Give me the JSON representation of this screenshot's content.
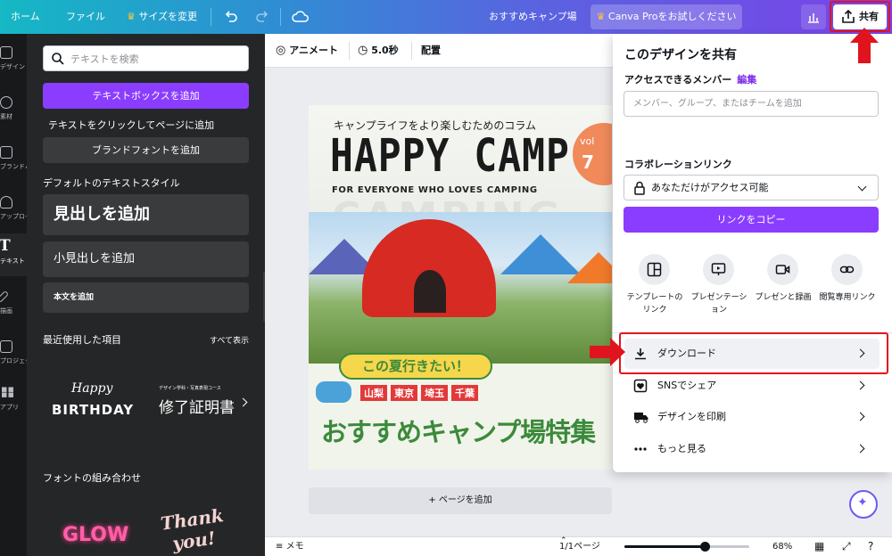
{
  "topbar": {
    "home": "ホーム",
    "file": "ファイル",
    "resize": "サイズを変更",
    "design_title": "おすすめキャンプ場",
    "pro_trial": "Canva Proをお試しください",
    "share": "共有"
  },
  "rail": [
    {
      "label": "デザイン",
      "icon": "template-icon"
    },
    {
      "label": "素材",
      "icon": "elements-icon"
    },
    {
      "label": "ブランドハブ",
      "icon": "brand-icon"
    },
    {
      "label": "アップロード",
      "icon": "upload-icon"
    },
    {
      "label": "テキスト",
      "icon": "text-icon"
    },
    {
      "label": "描画",
      "icon": "draw-icon"
    },
    {
      "label": "プロジェクト",
      "icon": "folder-icon"
    },
    {
      "label": "アプリ",
      "icon": "apps-icon"
    }
  ],
  "panel": {
    "search_placeholder": "テキストを検索",
    "add_textbox": "テキストボックスを追加",
    "hint": "テキストをクリックしてページに追加",
    "add_brand_font": "ブランドフォントを追加",
    "default_styles_title": "デフォルトのテキストスタイル",
    "heading": "見出しを追加",
    "subheading": "小見出しを追加",
    "body": "本文を追加",
    "recent_title": "最近使用した項目",
    "see_all": "すべて表示",
    "recent_1_line1": "Happy",
    "recent_1_line2": "BIRTHDAY",
    "recent_2_small": "デザイン学科・写真表現コース",
    "recent_2_main": "修了証明書",
    "combos_title": "フォントの組み合わせ",
    "combo_1": "GLOW",
    "combo_2_line1": "Thank",
    "combo_2_line2": "you!"
  },
  "toolbar": {
    "animate": "アニメート",
    "duration": "5.0秒",
    "position": "配置"
  },
  "canvas": {
    "kicker": "キャンプライフをより楽しむためのコラム",
    "headline": "HAPPY CAMP",
    "tagline": "FOR EVERYONE WHO LOVES CAMPING",
    "watermark": "CAMPING",
    "badge_top": "vol",
    "badge_num": "7",
    "summer": "この夏行きたい！",
    "places": [
      "山梨",
      "東京",
      "埼玉",
      "千葉"
    ],
    "bottom": "おすすめキャンプ場特集"
  },
  "editor": {
    "add_page": "+ ページを追加"
  },
  "footer": {
    "notes": "メモ",
    "pages": "1/1ページ",
    "zoom_percent": 68,
    "zoom_label": "68%"
  },
  "share_panel": {
    "title": "このデザインを共有",
    "access_label": "アクセスできるメンバー",
    "edit": "編集",
    "member_placeholder": "メンバー、グループ、またはチームを追加",
    "collab_label": "コラボレーションリンク",
    "access_value": "あなただけがアクセス可能",
    "copy_link": "リンクをコピー",
    "options": [
      {
        "line1": "テンプレートの",
        "line2": "リンク"
      },
      {
        "line1": "プレゼンテーシ",
        "line2": "ョン"
      },
      {
        "line1": "プレゼンと録画",
        "line2": ""
      },
      {
        "line1": "閲覧専用リンク",
        "line2": ""
      }
    ],
    "rows": [
      {
        "label": "ダウンロード"
      },
      {
        "label": "SNSでシェア"
      },
      {
        "label": "デザインを印刷"
      },
      {
        "label": "もっと見る"
      }
    ]
  },
  "colors": {
    "accent": "#8b3dff",
    "highlight": "#e0141e",
    "panel_bg": "#252627"
  }
}
